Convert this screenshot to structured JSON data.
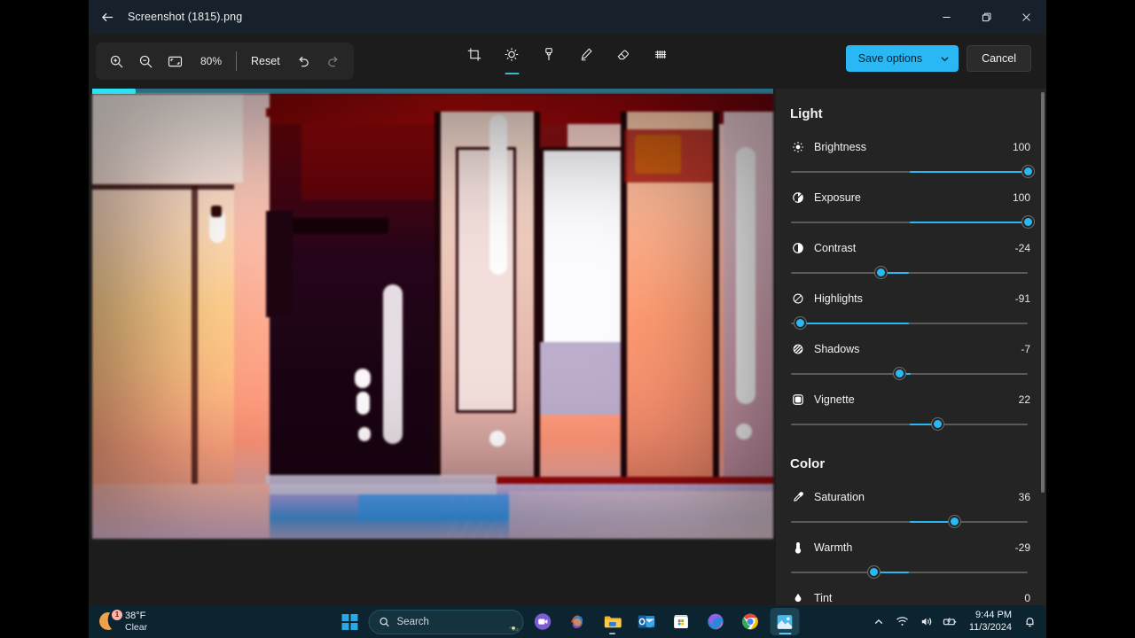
{
  "window": {
    "title": "Screenshot (1815).png",
    "back_icon": "back-arrow-icon",
    "controls": {
      "minimize": "minimize-icon",
      "restore": "restore-icon",
      "close": "close-icon"
    }
  },
  "toolbar": {
    "zoom_in": "zoom-in-icon",
    "zoom_out": "zoom-out-icon",
    "fit_to_window": "fit-to-window-icon",
    "zoom_level": "80%",
    "reset_label": "Reset",
    "undo": "undo-icon",
    "redo": "redo-icon",
    "tools": [
      {
        "name": "crop",
        "icon": "crop-icon",
        "active": false
      },
      {
        "name": "adjustment",
        "icon": "brightness-icon",
        "active": true
      },
      {
        "name": "markup-pen",
        "icon": "pen-icon",
        "active": false
      },
      {
        "name": "highlighter",
        "icon": "highlighter-icon",
        "active": false
      },
      {
        "name": "eraser",
        "icon": "eraser-icon",
        "active": false
      },
      {
        "name": "blur",
        "icon": "blur-mosaic-icon",
        "active": false
      }
    ],
    "save_options_label": "Save options",
    "save_options_chevron": "chevron-down-icon",
    "cancel_label": "Cancel",
    "accent_color": "#29b8f3"
  },
  "canvas": {
    "progress_percent": 6.5,
    "progress_color": "#29e3f5",
    "progress_track_color": "#2a6d82"
  },
  "panel": {
    "sections": [
      {
        "title": "Light",
        "controls": [
          {
            "label": "Brightness",
            "value": "100",
            "icon": "sun-icon",
            "fill_from": 50,
            "fill_to": 100,
            "thumb": 100
          },
          {
            "label": "Exposure",
            "value": "100",
            "icon": "exposure-icon",
            "fill_from": 50,
            "fill_to": 100,
            "thumb": 100
          },
          {
            "label": "Contrast",
            "value": "-24",
            "icon": "contrast-icon",
            "fill_from": 38,
            "fill_to": 50,
            "thumb": 38
          },
          {
            "label": "Highlights",
            "value": "-91",
            "icon": "highlights-icon",
            "fill_from": 4,
            "fill_to": 50,
            "thumb": 4
          },
          {
            "label": "Shadows",
            "value": "-7",
            "icon": "shadows-icon",
            "fill_from": 46,
            "fill_to": 50,
            "thumb": 46
          },
          {
            "label": "Vignette",
            "value": "22",
            "icon": "vignette-icon",
            "fill_from": 50,
            "fill_to": 62,
            "thumb": 62
          }
        ]
      },
      {
        "title": "Color",
        "controls": [
          {
            "label": "Saturation",
            "value": "36",
            "icon": "eyedropper-icon",
            "fill_from": 50,
            "fill_to": 69,
            "thumb": 69
          },
          {
            "label": "Warmth",
            "value": "-29",
            "icon": "thermometer-icon",
            "fill_from": 35,
            "fill_to": 50,
            "thumb": 35
          },
          {
            "label": "Tint",
            "value": "0",
            "icon": "tint-drop-icon",
            "fill_from": 50,
            "fill_to": 50,
            "thumb": 50
          }
        ]
      }
    ]
  },
  "taskbar": {
    "weather": {
      "temperature": "38°F",
      "condition": "Clear",
      "badge": "1",
      "icon": "moon-icon"
    },
    "start": {
      "icon": "windows-logo-icon"
    },
    "search": {
      "placeholder": "Search",
      "icon": "search-icon"
    },
    "apps": [
      {
        "name": "teams",
        "icon": "teams-icon"
      },
      {
        "name": "copilot",
        "icon": "copilot-icon"
      },
      {
        "name": "file-explorer",
        "icon": "folder-icon"
      },
      {
        "name": "outlook",
        "icon": "outlook-icon"
      },
      {
        "name": "microsoft-store",
        "icon": "store-icon"
      },
      {
        "name": "edge-copilot",
        "icon": "edge-icon"
      },
      {
        "name": "chrome",
        "icon": "chrome-icon"
      },
      {
        "name": "photos",
        "icon": "photos-icon"
      }
    ],
    "tray": {
      "chevron": "chevron-up-icon",
      "wifi": "wifi-icon",
      "volume": "volume-icon",
      "battery": "battery-icon",
      "time": "9:44 PM",
      "date": "11/3/2024",
      "notifications": "bell-icon"
    }
  }
}
